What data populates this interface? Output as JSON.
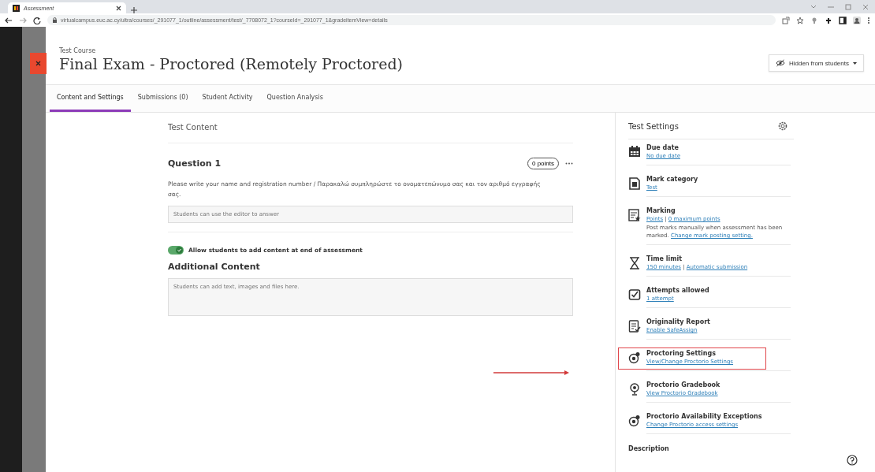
{
  "browser": {
    "tab_title": "Assessment",
    "url": "virtualcampus.euc.ac.cy/ultra/courses/_291077_1/outline/assessment/test/_7708072_1?courseId=_291077_1&gradeitemView=details"
  },
  "header": {
    "course": "Test Course",
    "title": "Final Exam - Proctored (Remotely Proctored)",
    "visibility": "Hidden from students"
  },
  "tabs": [
    {
      "label": "Content and Settings",
      "selected": true
    },
    {
      "label": "Submissions (0)",
      "selected": false
    },
    {
      "label": "Student Activity",
      "selected": false
    },
    {
      "label": "Question Analysis",
      "selected": false
    }
  ],
  "content": {
    "heading": "Test Content",
    "question": {
      "title": "Question 1",
      "points": "0 points",
      "prompt": "Please write your name and registration number / Παρακαλώ συμπληρώστε το ονοματεπώνυμο σας και τον αριθμό εγγραφής σας.",
      "answer_placeholder": "Students can use the editor to answer"
    },
    "toggle": {
      "label": "Allow students to add content at end of assessment",
      "on": true
    },
    "additional_heading": "Additional Content",
    "additional_placeholder": "Students can add text, images and files here."
  },
  "settings": {
    "title": "Test Settings",
    "items": [
      {
        "label": "Due date",
        "highlighted": false,
        "lines": [
          [
            {
              "kind": "link",
              "text": "No due date"
            }
          ]
        ]
      },
      {
        "label": "Mark category",
        "highlighted": false,
        "lines": [
          [
            {
              "kind": "link",
              "text": "Test"
            }
          ]
        ]
      },
      {
        "label": "Marking",
        "highlighted": false,
        "lines": [
          [
            {
              "kind": "link",
              "text": "Points"
            },
            {
              "kind": "text",
              "text": "|"
            },
            {
              "kind": "link",
              "text": "0 maximum points"
            }
          ],
          [
            {
              "kind": "text",
              "text": "Post marks manually when assessment has been marked."
            },
            {
              "kind": "link",
              "text": "Change mark posting setting."
            }
          ]
        ]
      },
      {
        "label": "Time limit",
        "highlighted": false,
        "lines": [
          [
            {
              "kind": "link",
              "text": "150 minutes"
            },
            {
              "kind": "text",
              "text": "|"
            },
            {
              "kind": "link",
              "text": "Automatic submission"
            }
          ]
        ]
      },
      {
        "label": "Attempts allowed",
        "highlighted": false,
        "lines": [
          [
            {
              "kind": "link",
              "text": "1 attempt"
            }
          ]
        ]
      },
      {
        "label": "Originality Report",
        "highlighted": false,
        "lines": [
          [
            {
              "kind": "link",
              "text": "Enable SafeAssign"
            }
          ]
        ]
      },
      {
        "label": "Proctoring Settings",
        "highlighted": true,
        "lines": [
          [
            {
              "kind": "link",
              "text": "View/Change Proctorio Settings"
            }
          ]
        ]
      },
      {
        "label": "Proctorio Gradebook",
        "highlighted": false,
        "lines": [
          [
            {
              "kind": "link",
              "text": "View Proctorio Gradebook"
            }
          ]
        ]
      },
      {
        "label": "Proctorio Availability Exceptions",
        "highlighted": false,
        "lines": [
          [
            {
              "kind": "link",
              "text": "Change Proctorio access settings"
            }
          ]
        ]
      }
    ],
    "description_heading": "Description"
  }
}
